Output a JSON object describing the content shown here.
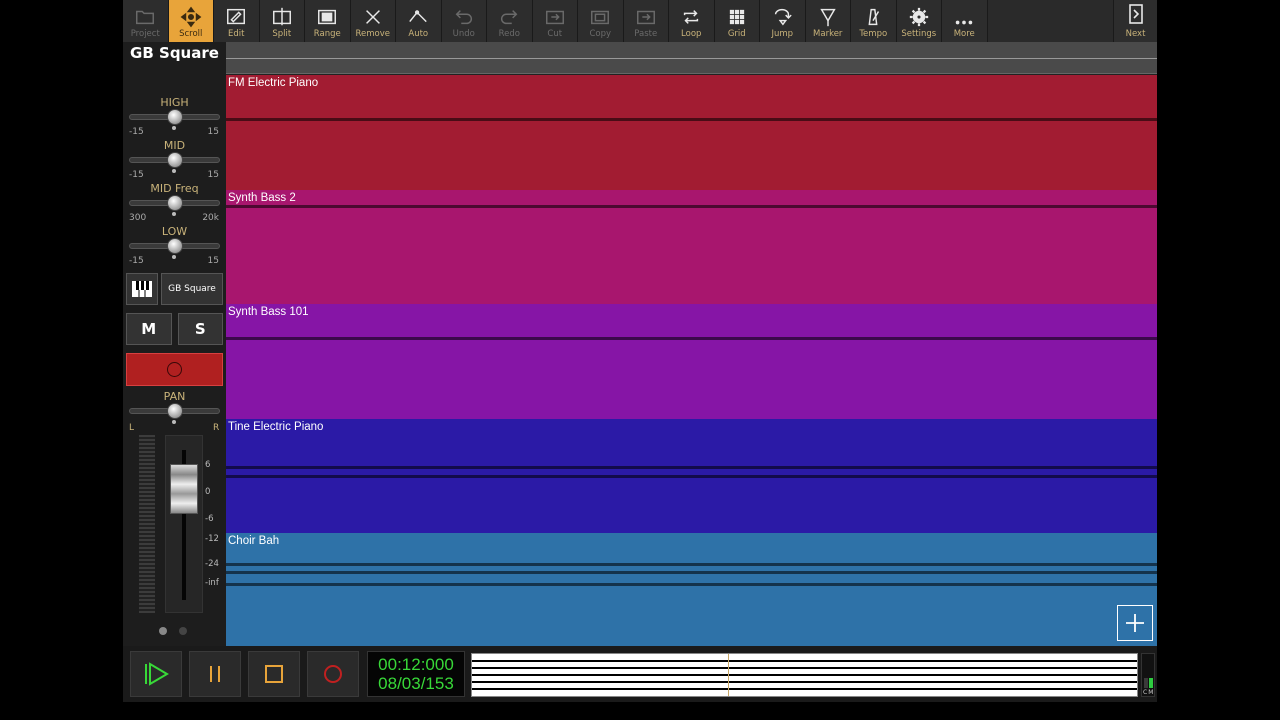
{
  "toolbar": {
    "buttons": [
      {
        "label": "Project",
        "icon": "folder-icon",
        "state": "dim"
      },
      {
        "label": "Scroll",
        "icon": "scroll-move-icon",
        "state": "active"
      },
      {
        "label": "Edit",
        "icon": "pencil-icon",
        "state": "normal"
      },
      {
        "label": "Split",
        "icon": "split-icon",
        "state": "normal"
      },
      {
        "label": "Range",
        "icon": "range-icon",
        "state": "normal"
      },
      {
        "label": "Remove",
        "icon": "close-x-icon",
        "state": "normal"
      },
      {
        "label": "Auto",
        "icon": "automation-icon",
        "state": "normal"
      },
      {
        "label": "Undo",
        "icon": "undo-icon",
        "state": "dim"
      },
      {
        "label": "Redo",
        "icon": "redo-icon",
        "state": "dim"
      },
      {
        "label": "Cut",
        "icon": "cut-icon",
        "state": "dim"
      },
      {
        "label": "Copy",
        "icon": "copy-icon",
        "state": "dim"
      },
      {
        "label": "Paste",
        "icon": "paste-icon",
        "state": "dim"
      },
      {
        "label": "Loop",
        "icon": "loop-icon",
        "state": "normal"
      },
      {
        "label": "Grid",
        "icon": "grid-icon",
        "state": "normal"
      },
      {
        "label": "Jump",
        "icon": "jump-icon",
        "state": "normal"
      },
      {
        "label": "Marker",
        "icon": "marker-icon",
        "state": "normal"
      },
      {
        "label": "Tempo",
        "icon": "metronome-icon",
        "state": "normal"
      },
      {
        "label": "Settings",
        "icon": "gear-icon",
        "state": "normal"
      },
      {
        "label": "More",
        "icon": "more-dots-icon",
        "state": "normal"
      }
    ],
    "next_label": "Next"
  },
  "strip": {
    "track_name": "GB Square",
    "eq": [
      {
        "label": "HIGH",
        "min": "-15",
        "max": "15",
        "level": 0.5
      },
      {
        "label": "MID",
        "min": "-15",
        "max": "15",
        "level": 0.5
      },
      {
        "label": "MID Freq",
        "min": "300",
        "max": "20k",
        "level": 0.5
      },
      {
        "label": "LOW",
        "min": "-15",
        "max": "15",
        "level": 0.5
      }
    ],
    "instrument_name": "GB Square",
    "mute_label": "M",
    "solo_label": "S",
    "pan_label": "PAN",
    "pan_left": "L",
    "pan_right": "R",
    "pan_level": 0.5,
    "db_ticks": [
      "6",
      "0",
      "-6",
      "-12",
      "-24",
      "-inf"
    ]
  },
  "tracks": [
    {
      "name": "FM Electric Piano",
      "color": "#a21c32"
    },
    {
      "name": "Synth Bass 2",
      "color": "#a8166e"
    },
    {
      "name": "Synth Bass 101",
      "color": "#8615a6"
    },
    {
      "name": "Tine Electric Piano",
      "color": "#2b1aa6"
    },
    {
      "name": "Choir Bah",
      "color": "#2e72a8"
    }
  ],
  "transport": {
    "time": "00:12:000",
    "position": "08/03/153",
    "cpu_labels": "CM"
  },
  "colors": {
    "accent": "#e8a43a",
    "label_gold": "#c9b37a",
    "record_red": "#b02020",
    "time_green": "#38d838"
  }
}
